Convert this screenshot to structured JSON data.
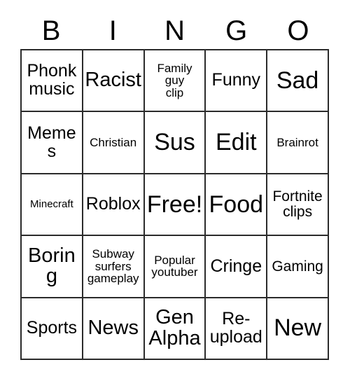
{
  "card": {
    "type": "bingo-card",
    "columns": 5,
    "rows": 5,
    "border_color": "#2b2b2b",
    "background_color": "#ffffff",
    "text_color": "#000000"
  },
  "header": {
    "letters": [
      "B",
      "I",
      "N",
      "G",
      "O"
    ]
  },
  "grid": {
    "rows": [
      {
        "cells": [
          {
            "text": "Phonk\nmusic",
            "size": "md"
          },
          {
            "text": "Racist",
            "size": "lg"
          },
          {
            "text": "Family\nguy\nclip",
            "size": "xs"
          },
          {
            "text": "Funny",
            "size": "md"
          },
          {
            "text": "Sad",
            "size": "xl"
          }
        ]
      },
      {
        "cells": [
          {
            "text": "Memes",
            "size": "md"
          },
          {
            "text": "Christian",
            "size": "xs"
          },
          {
            "text": "Sus",
            "size": "xl"
          },
          {
            "text": "Edit",
            "size": "xl"
          },
          {
            "text": "Brainrot",
            "size": "xs"
          }
        ]
      },
      {
        "cells": [
          {
            "text": "Minecraft",
            "size": "xxs"
          },
          {
            "text": "Roblox",
            "size": "md"
          },
          {
            "text": "Free!",
            "size": "xl"
          },
          {
            "text": "Food",
            "size": "xl"
          },
          {
            "text": "Fortnite\nclips",
            "size": "sm"
          }
        ]
      },
      {
        "cells": [
          {
            "text": "Boring",
            "size": "lg"
          },
          {
            "text": "Subway\nsurfers\ngameplay",
            "size": "xs"
          },
          {
            "text": "Popular\nyoutuber",
            "size": "xs"
          },
          {
            "text": "Cringe",
            "size": "md"
          },
          {
            "text": "Gaming",
            "size": "sm"
          }
        ]
      },
      {
        "cells": [
          {
            "text": "Sports",
            "size": "md"
          },
          {
            "text": "News",
            "size": "lg"
          },
          {
            "text": "Gen\nAlpha",
            "size": "lg"
          },
          {
            "text": "Re-\nupload",
            "size": "md"
          },
          {
            "text": "New",
            "size": "xl"
          }
        ]
      }
    ]
  }
}
